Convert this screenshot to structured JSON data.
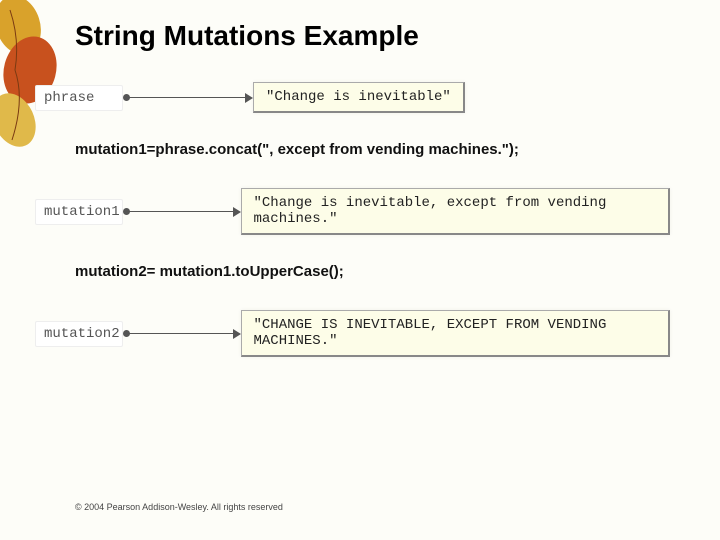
{
  "title": "String Mutations Example",
  "row1": {
    "var": "phrase",
    "value": "\"Change is inevitable\""
  },
  "code1": "mutation1=phrase.concat(\", except from vending machines.\");",
  "row2": {
    "var": "mutation1",
    "value": "\"Change is inevitable, except from vending machines.\""
  },
  "code2": "mutation2= mutation1.toUpperCase();",
  "row3": {
    "var": "mutation2",
    "value": "\"CHANGE IS INEVITABLE, EXCEPT FROM VENDING MACHINES.\""
  },
  "footer": "© 2004 Pearson Addison-Wesley. All rights reserved"
}
